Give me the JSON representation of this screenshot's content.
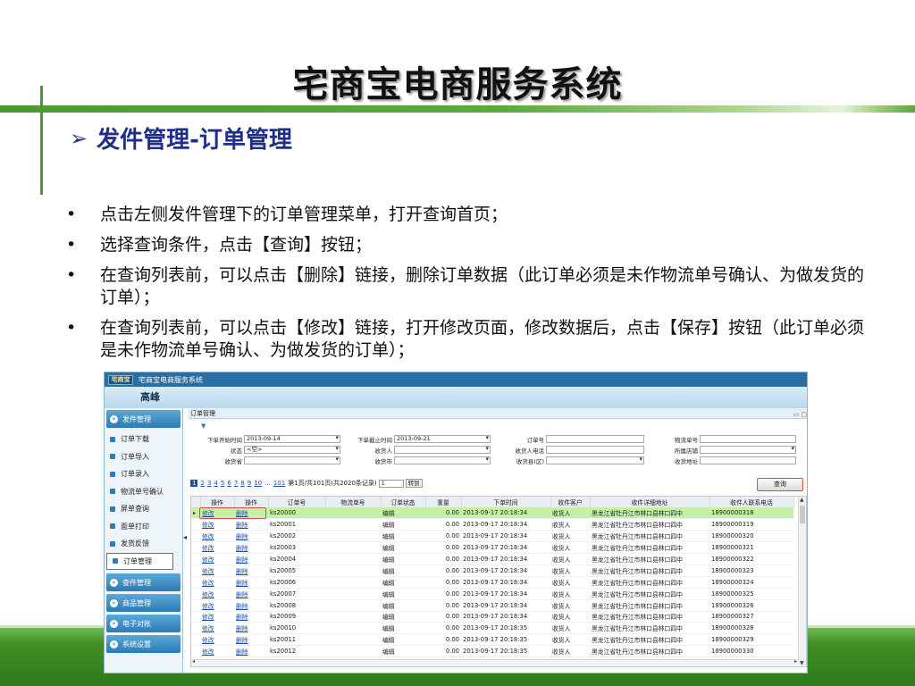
{
  "slide": {
    "title": "宅商宝电商服务系统",
    "section": "发件管理-订单管理",
    "arrow": "➢",
    "bullets": [
      "点击左侧发件管理下的订单管理菜单，打开查询首页；",
      "选择查询条件，点击【查询】按钮；",
      "在查询列表前，可以点击【删除】链接，删除订单数据（此订单必须是未作物流单号确认、为做发货的订单）；",
      "在查询列表前，可以点击【修改】链接，打开修改页面，修改数据后，点击【保存】按钮（此订单必须是未作物流单号确认、为做发货的订单）；"
    ]
  },
  "app": {
    "logo": "宅商宝",
    "window_title": "宅商宝电商服务系统",
    "user": "高峰",
    "sidebar": {
      "groups": [
        {
          "label": "发件管理",
          "items": [
            "订单下载",
            "订单导入",
            "订单录入",
            "物流单号确认",
            "屏单查询",
            "面单打印",
            "发货反馈",
            "订单管理"
          ]
        },
        {
          "label": "查件管理",
          "items": []
        },
        {
          "label": "商品管理",
          "items": []
        },
        {
          "label": "电子对账",
          "items": []
        },
        {
          "label": "系统设置",
          "items": []
        }
      ],
      "active_item": "订单管理"
    },
    "panel_title": "订单管理",
    "filters": {
      "start_label": "下单开始时间",
      "start_value": "2013-09-14",
      "end_label": "下单截止时间",
      "end_value": "2013-09-21",
      "order_no_label": "订单号",
      "order_no_value": "",
      "tracking_label": "物流单号",
      "tracking_value": "",
      "status_label": "状态",
      "status_value": "<空>",
      "receiver_label": "收货人",
      "receiver_value": "",
      "phone_label": "收货人电话",
      "phone_value": "",
      "store_label": "所属店铺",
      "store_value": "",
      "province_label": "收货省",
      "province_value": "",
      "city_label": "收货市",
      "city_value": "",
      "county_label": "收货县(区)",
      "county_value": "",
      "address_label": "收货地址",
      "address_value": ""
    },
    "pager": {
      "pages": [
        "1",
        "2",
        "3",
        "4",
        "5",
        "6",
        "7",
        "8",
        "9",
        "10",
        "...",
        "101"
      ],
      "summary": "第1页/共101页(共2020条记录)",
      "goto_value": "1",
      "goto_label": "转到"
    },
    "query_button": "查询",
    "table": {
      "columns": [
        "操作",
        "操作",
        "订单号",
        "物流单号",
        "订单状态",
        "重量",
        "下单时间",
        "收件客户",
        "收件详细地址",
        "收件人联系电话"
      ],
      "rows": [
        [
          "修改",
          "删除",
          "ks20000",
          "",
          "编辑",
          "0.00",
          "2013-09-17 20:18:34",
          "收货人",
          "黑龙江省牡丹江市林口县林口四中",
          "18900000318"
        ],
        [
          "修改",
          "删除",
          "ks20001",
          "",
          "编辑",
          "0.00",
          "2013-09-17 20:18:34",
          "收货人",
          "黑龙江省牡丹江市林口县林口四中",
          "18900000319"
        ],
        [
          "修改",
          "删除",
          "ks20002",
          "",
          "编辑",
          "0.00",
          "2013-09-17 20:18:34",
          "收货人",
          "黑龙江省牡丹江市林口县林口四中",
          "18900000320"
        ],
        [
          "修改",
          "删除",
          "ks20003",
          "",
          "编辑",
          "0.00",
          "2013-09-17 20:18:34",
          "收货人",
          "黑龙江省牡丹江市林口县林口四中",
          "18900000321"
        ],
        [
          "修改",
          "删除",
          "ks20004",
          "",
          "编辑",
          "0.00",
          "2013-09-17 20:18:34",
          "收货人",
          "黑龙江省牡丹江市林口县林口四中",
          "18900000322"
        ],
        [
          "修改",
          "删除",
          "ks20005",
          "",
          "编辑",
          "0.00",
          "2013-09-17 20:18:34",
          "收货人",
          "黑龙江省牡丹江市林口县林口四中",
          "18900000323"
        ],
        [
          "修改",
          "删除",
          "ks20006",
          "",
          "编辑",
          "0.00",
          "2013-09-17 20:18:34",
          "收货人",
          "黑龙江省牡丹江市林口县林口四中",
          "18900000324"
        ],
        [
          "修改",
          "删除",
          "ks20007",
          "",
          "编辑",
          "0.00",
          "2013-09-17 20:18:34",
          "收货人",
          "黑龙江省牡丹江市林口县林口四中",
          "18900000325"
        ],
        [
          "修改",
          "删除",
          "ks20008",
          "",
          "编辑",
          "0.00",
          "2013-09-17 20:18:34",
          "收货人",
          "黑龙江省牡丹江市林口县林口四中",
          "18900000326"
        ],
        [
          "修改",
          "删除",
          "ks20009",
          "",
          "编辑",
          "0.00",
          "2013-09-17 20:18:34",
          "收货人",
          "黑龙江省牡丹江市林口县林口四中",
          "18900000327"
        ],
        [
          "修改",
          "删除",
          "ks20010",
          "",
          "编辑",
          "0.00",
          "2013-09-17 20:18:35",
          "收货人",
          "黑龙江省牡丹江市林口县林口四中",
          "18900000328"
        ],
        [
          "修改",
          "删除",
          "ks20011",
          "",
          "编辑",
          "0.00",
          "2013-09-17 20:18:35",
          "收货人",
          "黑龙江省牡丹江市林口县林口四中",
          "18900000329"
        ],
        [
          "修改",
          "删除",
          "ks20012",
          "",
          "编辑",
          "0.00",
          "2013-09-17 20:18:35",
          "收货人",
          "黑龙江省牡丹江市林口县林口四中",
          "18900000330"
        ]
      ]
    },
    "colors": {
      "accent": "#2c7cb5",
      "selected_row": "#c7f0a7",
      "highlight": "#d94a4a",
      "slide_green": "#4a9a2c"
    },
    "icons": [
      "section-arrow-icon",
      "sidebar-bullet-icon",
      "dropdown-icon",
      "row-pointer-icon",
      "scroll-arrow-icon"
    ]
  }
}
